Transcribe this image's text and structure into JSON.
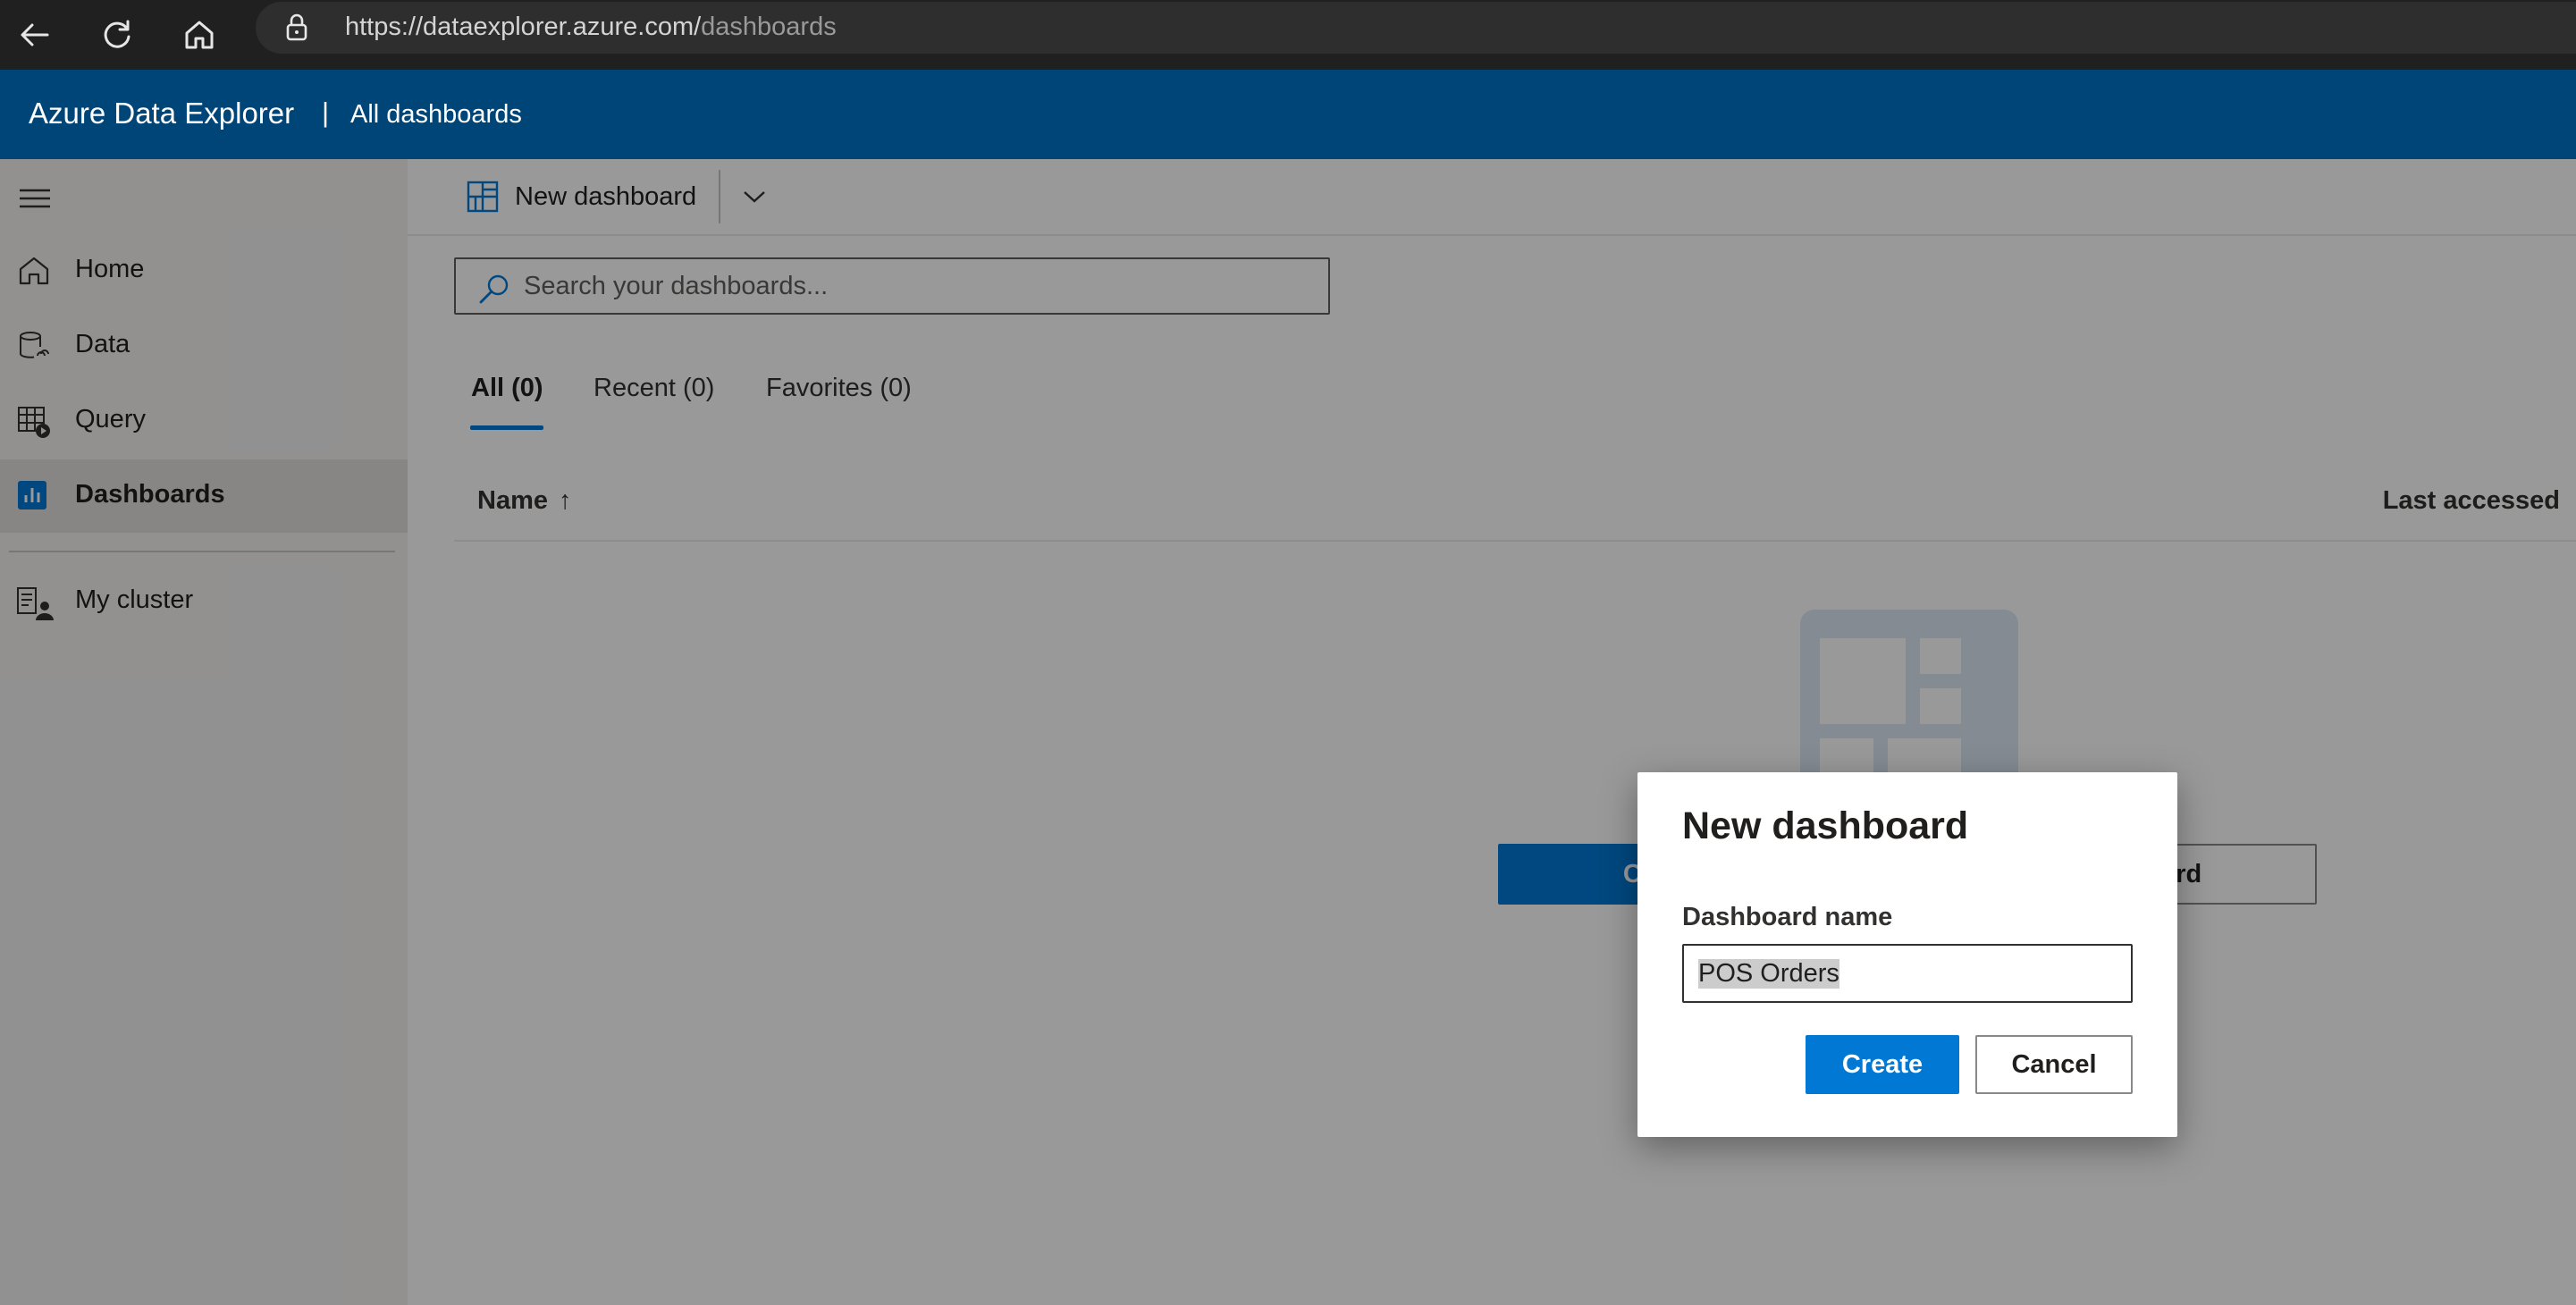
{
  "browser": {
    "url_host": "https://dataexplorer.azure.com/",
    "url_path": "dashboards",
    "icons": [
      "back-arrow-icon",
      "refresh-icon",
      "home-icon",
      "lock-icon"
    ]
  },
  "header": {
    "app_title": "Azure Data Explorer",
    "separator": "|",
    "breadcrumb": "All dashboards",
    "background_color": "#004578"
  },
  "sidebar": {
    "menu_icon": "hamburger-icon",
    "items": [
      {
        "label": "Home",
        "icon": "home-icon",
        "active": false
      },
      {
        "label": "Data",
        "icon": "database-icon",
        "active": false
      },
      {
        "label": "Query",
        "icon": "query-table-icon",
        "active": false
      },
      {
        "label": "Dashboards",
        "icon": "dashboard-chart-icon",
        "active": true
      }
    ],
    "cluster": {
      "label": "My cluster",
      "icon": "cluster-icon"
    }
  },
  "toolbar": {
    "new_dashboard_label": "New dashboard",
    "new_dashboard_icon": "dashboard-grid-icon",
    "dropdown_icon": "chevron-down-icon"
  },
  "search": {
    "placeholder": "Search your dashboards...",
    "value": "",
    "icon": "search-icon"
  },
  "tabs": [
    {
      "label": "All (0)",
      "active": true
    },
    {
      "label": "Recent (0)",
      "active": false
    },
    {
      "label": "Favorites (0)",
      "active": false
    }
  ],
  "table": {
    "columns": [
      "Name",
      "Last accessed"
    ],
    "sort_indicator": "↑",
    "rows": []
  },
  "empty_state": {
    "illustration": "dashboard-placeholder-icon",
    "create_button_partial": "Create",
    "import_button_partial": "shboard"
  },
  "dialog": {
    "title": "New dashboard",
    "field_label": "Dashboard name",
    "field_value": "POS Orders",
    "create_label": "Create",
    "cancel_label": "Cancel"
  },
  "colors": {
    "accent": "#0078d4",
    "sidebar_bg": "#f3f2f1",
    "browser_bg": "#202020"
  }
}
